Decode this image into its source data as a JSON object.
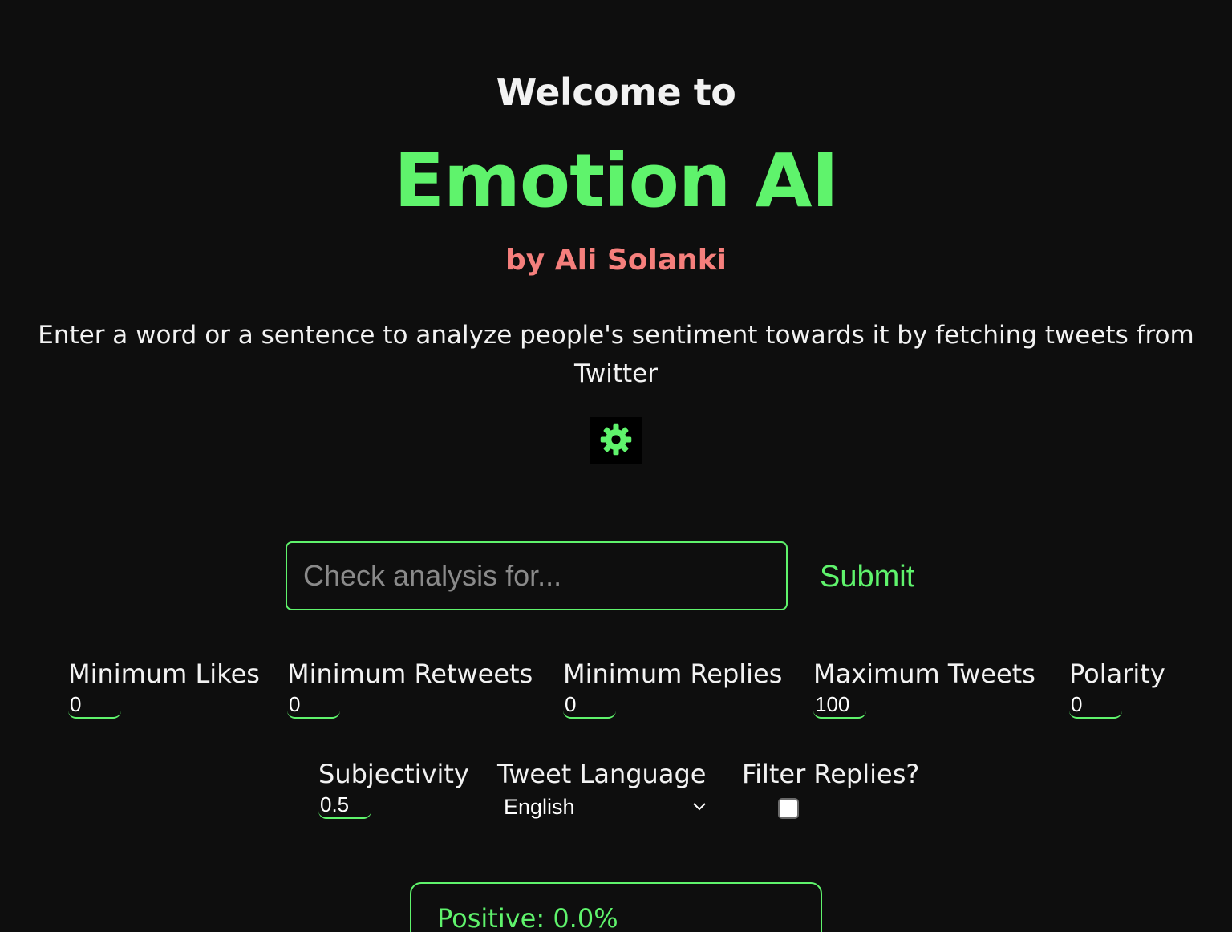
{
  "header": {
    "welcome": "Welcome to",
    "app_name": "Emotion AI",
    "byline": "by Ali Solanki",
    "description": "Enter a word or a sentence to analyze people's sentiment towards it by fetching tweets from Twitter"
  },
  "settings": {
    "icon": "gear-icon",
    "color": "#5ff36c"
  },
  "search": {
    "placeholder": "Check analysis for...",
    "value": "",
    "submit_label": "Submit"
  },
  "filters": {
    "min_likes": {
      "label": "Minimum Likes",
      "value": "0"
    },
    "min_retweets": {
      "label": "Minimum Retweets",
      "value": "0"
    },
    "min_replies": {
      "label": "Minimum Replies",
      "value": "0"
    },
    "max_tweets": {
      "label": "Maximum Tweets",
      "value": "100"
    },
    "polarity": {
      "label": "Polarity",
      "value": "0"
    },
    "subjectivity": {
      "label": "Subjectivity",
      "value": "0.5"
    },
    "language": {
      "label": "Tweet Language",
      "value": "English"
    },
    "filter_replies": {
      "label": "Filter Replies?",
      "checked": false
    }
  },
  "results": {
    "positive": "Positive: 0.0%"
  },
  "colors": {
    "background": "#0e0e0e",
    "accent": "#5ff36c",
    "byline": "#f57f7c",
    "text": "#f2f2f2"
  }
}
